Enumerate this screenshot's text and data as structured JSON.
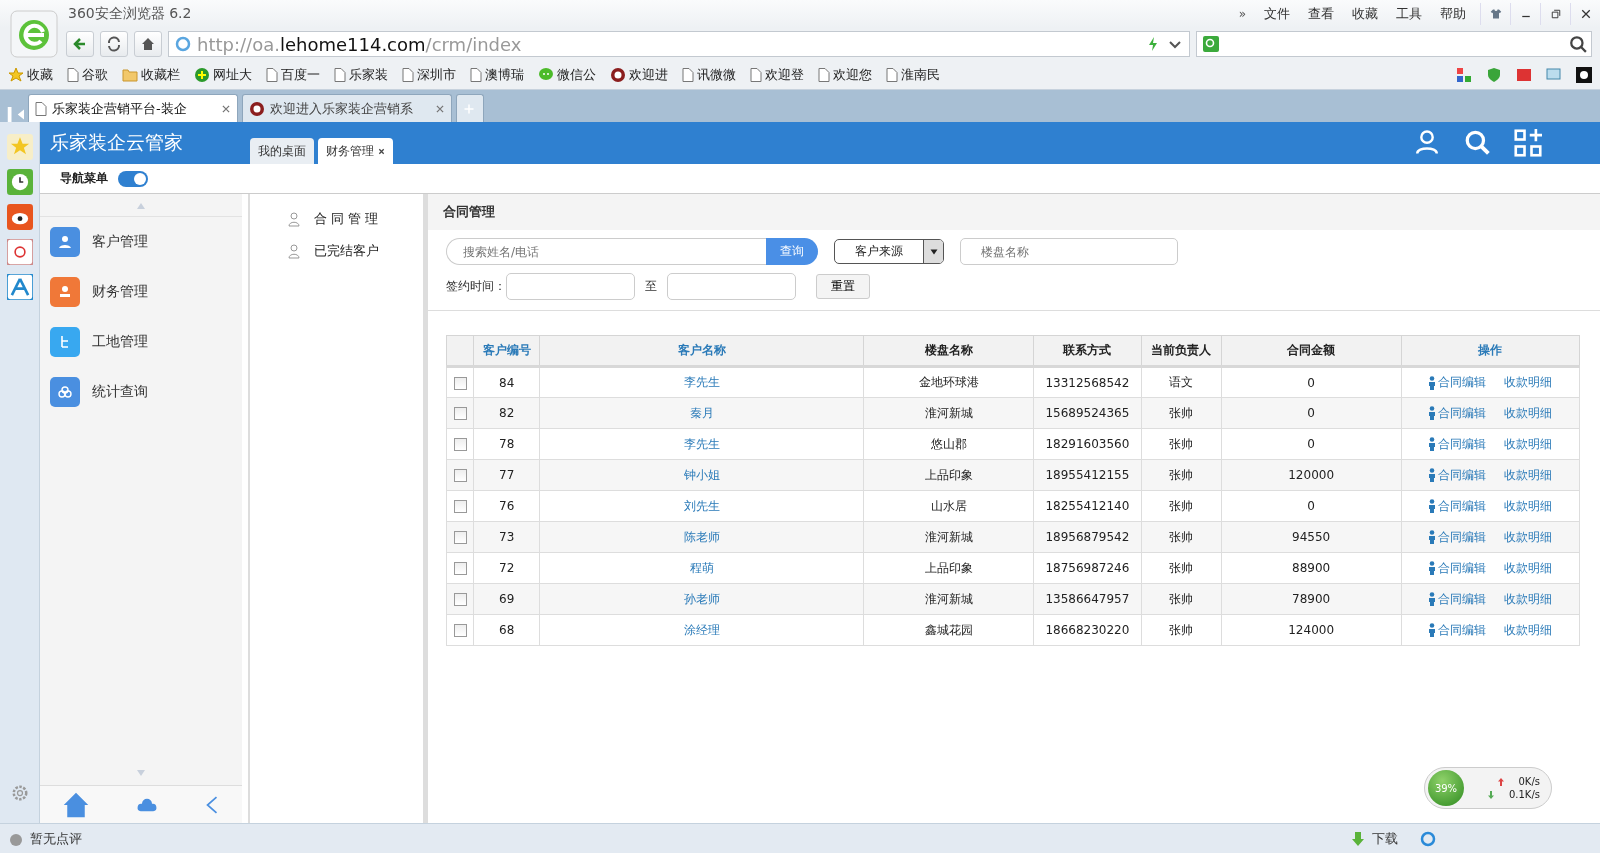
{
  "browser": {
    "title": "360安全浏览器 6.2",
    "more": "»",
    "menu": [
      "文件",
      "查看",
      "收藏",
      "工具",
      "帮助"
    ],
    "url": {
      "prefix": "http://oa.",
      "domain": "lehome114.com",
      "path": "/crm/index"
    },
    "bookmarks": [
      {
        "label": "收藏",
        "kind": "star"
      },
      {
        "label": "谷歌",
        "kind": "page"
      },
      {
        "label": "收藏栏",
        "kind": "folder"
      },
      {
        "label": "网址大",
        "kind": "plus"
      },
      {
        "label": "百度一",
        "kind": "page"
      },
      {
        "label": "乐家装",
        "kind": "page"
      },
      {
        "label": "深圳市",
        "kind": "page"
      },
      {
        "label": "澳博瑞",
        "kind": "page"
      },
      {
        "label": "微信公",
        "kind": "chat"
      },
      {
        "label": "欢迎进",
        "kind": "seal"
      },
      {
        "label": "讯微微",
        "kind": "page"
      },
      {
        "label": "欢迎登",
        "kind": "page"
      },
      {
        "label": "欢迎您",
        "kind": "page"
      },
      {
        "label": "淮南民",
        "kind": "page"
      }
    ],
    "tabs": [
      {
        "label": "乐家装企营销平台-装企",
        "kind": "page",
        "selected": true
      },
      {
        "label": "欢迎进入乐家装企营销系",
        "kind": "seal",
        "selected": false
      }
    ]
  },
  "app": {
    "title": "乐家装企云管家",
    "tabs": [
      {
        "label": "我的桌面",
        "selected": false,
        "closable": false
      },
      {
        "label": "财务管理",
        "selected": true,
        "closable": true
      }
    ],
    "nav_toggle": {
      "label": "导航菜单",
      "on": true
    },
    "sidebar": [
      {
        "label": "客户管理",
        "kind": "person",
        "color": "#4a8fe0"
      },
      {
        "label": "财务管理",
        "kind": "stamp",
        "color": "#f07838"
      },
      {
        "label": "工地管理",
        "kind": "tree",
        "color": "#38a8f0"
      },
      {
        "label": "统计查询",
        "kind": "cloud",
        "color": "#4a8fe0"
      }
    ],
    "submenu": [
      "合 同 管 理",
      "已完结客户"
    ],
    "panel": {
      "title": "合同管理",
      "search_placeholder": "搜索姓名/电话",
      "query": "查询",
      "source_select": "客户来源",
      "building_placeholder": "楼盘名称",
      "date_label": "签约时间：",
      "date_sep": "至",
      "reset": "重置"
    },
    "table": {
      "columns": [
        {
          "label": "客户编号",
          "color": "#2a7ab8"
        },
        {
          "label": "客户名称",
          "color": "#2a7ab8"
        },
        {
          "label": "楼盘名称",
          "color": "#222222"
        },
        {
          "label": "联系方式",
          "color": "#222222"
        },
        {
          "label": "当前负责人",
          "color": "#222222"
        },
        {
          "label": "合同金额",
          "color": "#222222"
        },
        {
          "label": "操作",
          "color": "#2a7ab8"
        }
      ],
      "rows": [
        {
          "checked": false,
          "cells": [
            "84",
            "李先生",
            "金地环球港",
            "13312568542",
            "语文",
            "0"
          ],
          "actions": [
            "合同编辑",
            "收款明细"
          ]
        },
        {
          "checked": false,
          "cells": [
            "82",
            "秦月",
            "淮河新城",
            "15689524365",
            "张帅",
            "0"
          ],
          "actions": [
            "合同编辑",
            "收款明细"
          ]
        },
        {
          "checked": false,
          "cells": [
            "78",
            "李先生",
            "悠山郡",
            "18291603560",
            "张帅",
            "0"
          ],
          "actions": [
            "合同编辑",
            "收款明细"
          ]
        },
        {
          "checked": false,
          "cells": [
            "77",
            "钟小姐",
            "上品印象",
            "18955412155",
            "张帅",
            "120000"
          ],
          "actions": [
            "合同编辑",
            "收款明细"
          ]
        },
        {
          "checked": false,
          "cells": [
            "76",
            "刘先生",
            "山水居",
            "18255412140",
            "张帅",
            "0"
          ],
          "actions": [
            "合同编辑",
            "收款明细"
          ]
        },
        {
          "checked": false,
          "cells": [
            "73",
            "陈老师",
            "淮河新城",
            "18956879542",
            "张帅",
            "94550"
          ],
          "actions": [
            "合同编辑",
            "收款明细"
          ]
        },
        {
          "checked": false,
          "cells": [
            "72",
            "程萌",
            "上品印象",
            "18756987246",
            "张帅",
            "88900"
          ],
          "actions": [
            "合同编辑",
            "收款明细"
          ]
        },
        {
          "checked": false,
          "cells": [
            "69",
            "孙老师",
            "淮河新城",
            "13586647957",
            "张帅",
            "78900"
          ],
          "actions": [
            "合同编辑",
            "收款明细"
          ]
        },
        {
          "checked": false,
          "cells": [
            "68",
            "涂经理",
            "鑫城花园",
            "18668230220",
            "张帅",
            "124000"
          ],
          "actions": [
            "合同编辑",
            "收款明细"
          ]
        }
      ]
    }
  },
  "status_bar": {
    "review": "暂无点评",
    "download": "下载",
    "speed": {
      "percent": "39%",
      "up": "0K/s",
      "down": "0.1K/s"
    }
  }
}
